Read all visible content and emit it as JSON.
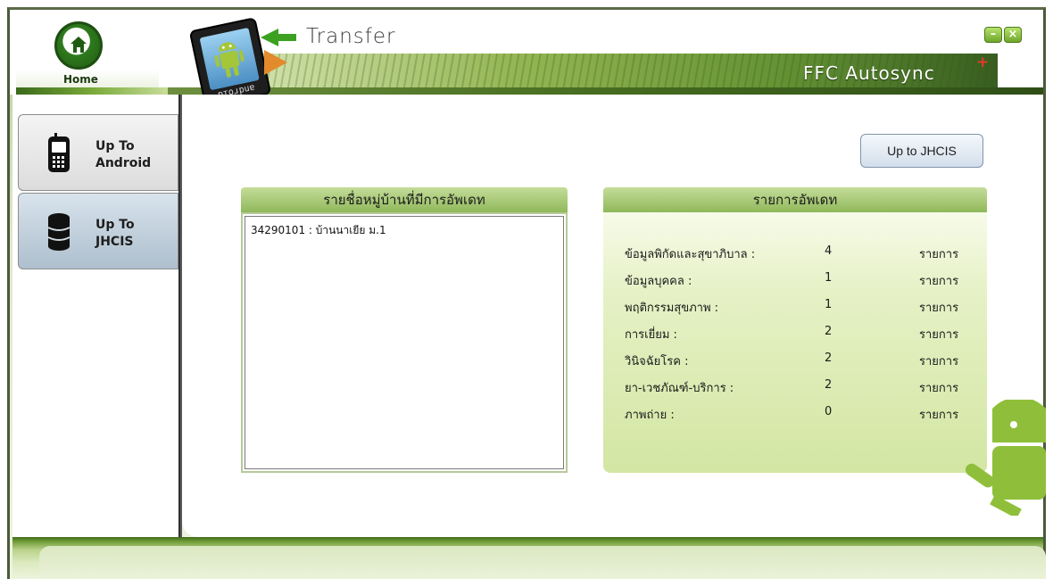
{
  "window": {
    "title": "Transfer",
    "brand": "FFC Autosync",
    "brand_mark": "+",
    "minimize": "–",
    "close": "×"
  },
  "header": {
    "home_label": "Home",
    "tablet_label": "android"
  },
  "sidebar": {
    "items": [
      {
        "label": "Up To\nAndroid",
        "icon": "phone-icon"
      },
      {
        "label": "Up To\nJHCIS",
        "icon": "database-icon"
      }
    ]
  },
  "actions": {
    "upload_label": "Up to JHCIS"
  },
  "village_list": {
    "heading": "รายชื่อหมู่บ้านที่มีการอัพเดท",
    "items": [
      "34290101 : บ้านนาเยีย ม.1"
    ]
  },
  "updates": {
    "heading": "รายการอัพเดท",
    "unit": "รายการ",
    "rows": [
      {
        "label": "ข้อมูลพิกัดและสุขาภิบาล :",
        "value": "4"
      },
      {
        "label": "ข้อมูลบุคคล :",
        "value": "1"
      },
      {
        "label": "พฤติกรรมสุขภาพ :",
        "value": "1"
      },
      {
        "label": "การเยี่ยม :",
        "value": "2"
      },
      {
        "label": "วินิจฉัยโรค :",
        "value": "2"
      },
      {
        "label": "ยา-เวชภัณฑ์-บริการ :",
        "value": "2"
      },
      {
        "label": "ภาพถ่าย :",
        "value": "0"
      }
    ]
  },
  "colors": {
    "accent": "#6ea62b",
    "panel_head": "#a8c878",
    "dark_frame": "#4b5a3a"
  }
}
